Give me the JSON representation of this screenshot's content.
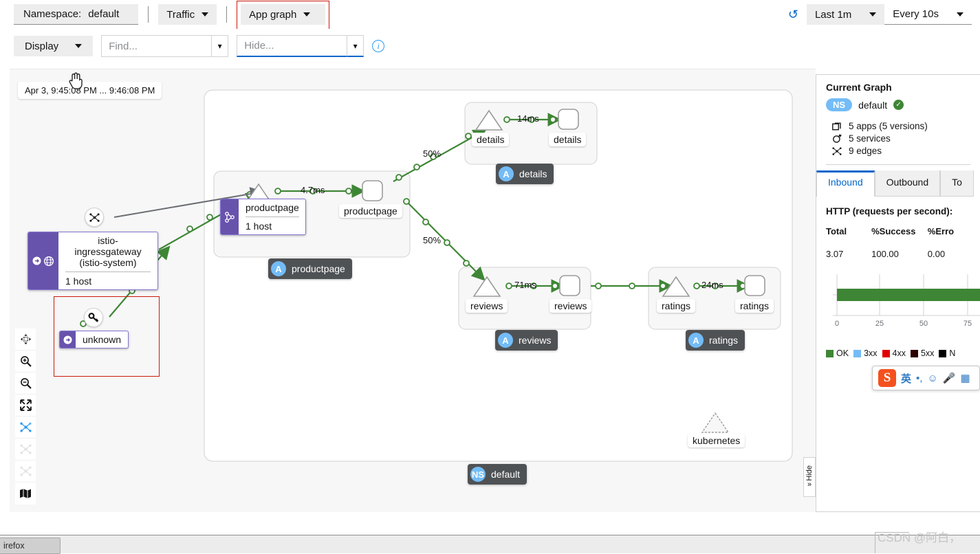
{
  "toolbar": {
    "namespace_label": "Namespace:",
    "namespace_value": "default",
    "traffic_label": "Traffic",
    "graph_type_label": "App graph",
    "refresh_icon": "history-icon",
    "time_range_label": "Last 1m",
    "refresh_interval_label": "Every 10s",
    "display_label": "Display",
    "find_placeholder": "Find...",
    "find_value": "",
    "hide_placeholder": "Hide...",
    "hide_value": "",
    "info_icon": "info-icon"
  },
  "graph": {
    "timestamp": "Apr 3, 9:45:08 PM ... 9:46:08 PM",
    "namespace_badge": {
      "abbr": "NS",
      "label": "default"
    },
    "groups": [
      {
        "abbr": "A",
        "label": "details"
      },
      {
        "abbr": "A",
        "label": "productpage"
      },
      {
        "abbr": "A",
        "label": "reviews"
      },
      {
        "abbr": "A",
        "label": "ratings"
      }
    ],
    "nodes": [
      {
        "name": "details-workload",
        "label": "details"
      },
      {
        "name": "details-service",
        "label": "details"
      },
      {
        "name": "productpage-workload",
        "label": "productpage"
      },
      {
        "name": "productpage-service",
        "label": "productpage"
      },
      {
        "name": "reviews-workload",
        "label": "reviews"
      },
      {
        "name": "reviews-service",
        "label": "reviews"
      },
      {
        "name": "ratings-workload",
        "label": "ratings"
      },
      {
        "name": "ratings-service",
        "label": "ratings"
      },
      {
        "name": "kubernetes-service",
        "label": "kubernetes"
      }
    ],
    "ingress": {
      "title_line1": "istio-ingressgateway",
      "title_line2": "(istio-system)",
      "sub": "1 host"
    },
    "productpage_box": {
      "title_line1": "productpage",
      "title_line2": "",
      "sub": "1 host"
    },
    "unknown": {
      "label": "unknown"
    },
    "edge_labels": [
      {
        "name": "edge-details-latency",
        "text": "14ms"
      },
      {
        "name": "edge-productpage-latency",
        "text": "4.7ms"
      },
      {
        "name": "edge-details-pct",
        "text": "50%"
      },
      {
        "name": "edge-reviews-pct",
        "text": "50%"
      },
      {
        "name": "edge-reviews-latency",
        "text": "71ms"
      },
      {
        "name": "edge-ratings-latency",
        "text": "24ms"
      }
    ],
    "left_tools": [
      {
        "name": "pan-tool",
        "icon": "arrows-move-icon"
      },
      {
        "name": "zoom-in-tool",
        "icon": "zoom-in-icon"
      },
      {
        "name": "zoom-out-tool",
        "icon": "zoom-out-icon"
      },
      {
        "name": "fit-to-screen-tool",
        "icon": "expand-icon"
      },
      {
        "name": "layout-dagre-tool",
        "icon": "topology-icon"
      },
      {
        "name": "layout-cola-tool",
        "icon": "topology-icon"
      },
      {
        "name": "layout-cose-tool",
        "icon": "topology-icon"
      },
      {
        "name": "legend-tool",
        "icon": "map-icon"
      }
    ]
  },
  "side_panel": {
    "title": "Current Graph",
    "ns_abbr": "NS",
    "ns_name": "default",
    "health_icon": "check-circle-icon",
    "stats": [
      {
        "icon": "apps-icon",
        "text": "5 apps (5 versions)"
      },
      {
        "icon": "services-icon",
        "text": "5 services"
      },
      {
        "icon": "edges-icon",
        "text": "9 edges"
      }
    ],
    "tabs": [
      {
        "label": "Inbound",
        "active": true
      },
      {
        "label": "Outbound",
        "active": false
      },
      {
        "label": "To",
        "active": false
      }
    ],
    "http_title": "HTTP (requests per second):",
    "metrics_headers": [
      "Total",
      "%Success",
      "%Erro"
    ],
    "metrics_values": [
      "3.07",
      "100.00",
      "0.00"
    ],
    "hide_tab_label": "Hide"
  },
  "chart_data": {
    "type": "bar",
    "title": "HTTP (requests per second)",
    "orientation": "horizontal",
    "categories": [
      ""
    ],
    "series": [
      {
        "name": "OK",
        "values": [
          100
        ],
        "color": "#3e8635"
      },
      {
        "name": "3xx",
        "values": [
          0
        ],
        "color": "#73bcf7"
      },
      {
        "name": "4xx",
        "values": [
          0
        ],
        "color": "#e00"
      },
      {
        "name": "5xx",
        "values": [
          0
        ],
        "color": "#2c0000"
      },
      {
        "name": "N",
        "values": [
          0
        ],
        "color": "#000000"
      }
    ],
    "xticks": [
      "0",
      "25",
      "50",
      "75"
    ],
    "xlim": [
      0,
      100
    ],
    "grid": true,
    "legend_position": "bottom",
    "legend": [
      "OK",
      "3xx",
      "4xx",
      "5xx",
      "N"
    ]
  },
  "ime": {
    "logo": "sogou-logo",
    "mode": "英",
    "punct_icon": "punctuation-icon",
    "emoji_icon": "smiley-icon",
    "mic_icon": "microphone-icon",
    "more_icon": "more-icon"
  },
  "taskbar": {
    "app_label": "irefox"
  },
  "watermark": "CSDN @阿白，"
}
